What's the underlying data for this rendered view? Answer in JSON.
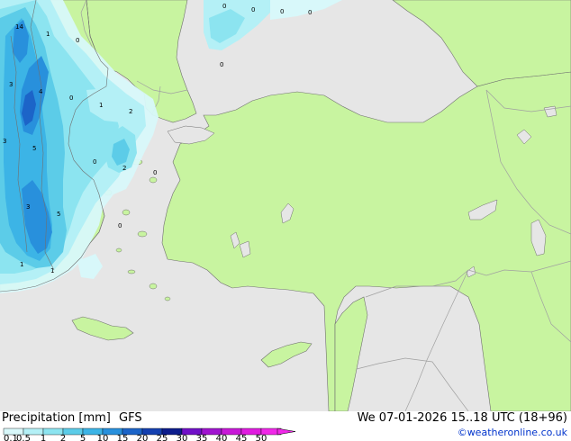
{
  "footer": {
    "title_prefix": "Precipitation [mm]",
    "model": "GFS",
    "datetime": "We 07-01-2026 15..18 UTC (18+96)",
    "credit": "©weatheronline.co.uk"
  },
  "legend": {
    "labels": [
      "0.1",
      "0.5",
      "1",
      "2",
      "5",
      "10",
      "15",
      "20",
      "25",
      "30",
      "35",
      "40",
      "45",
      "50"
    ],
    "colors": [
      "#d8f8fa",
      "#b4f0f6",
      "#8ce4f0",
      "#5ccce8",
      "#3cb4e6",
      "#2890dc",
      "#1c64c8",
      "#1440b0",
      "#0c1c8c",
      "#7010c8",
      "#a014d0",
      "#c818d8",
      "#e01ce0",
      "#f028e8"
    ]
  },
  "map_labels": [
    "14",
    "1",
    "0",
    "3",
    "4",
    "0",
    "1",
    "2",
    "3",
    "5",
    "0",
    "2",
    "0",
    "3",
    "5",
    "0",
    "1",
    "1",
    "0",
    "0",
    "0",
    "0",
    "0"
  ],
  "colors": {
    "land": "#c8f4a0",
    "sea": "#e6e6e6",
    "border": "#a0a0a0",
    "coast": "#707070"
  }
}
